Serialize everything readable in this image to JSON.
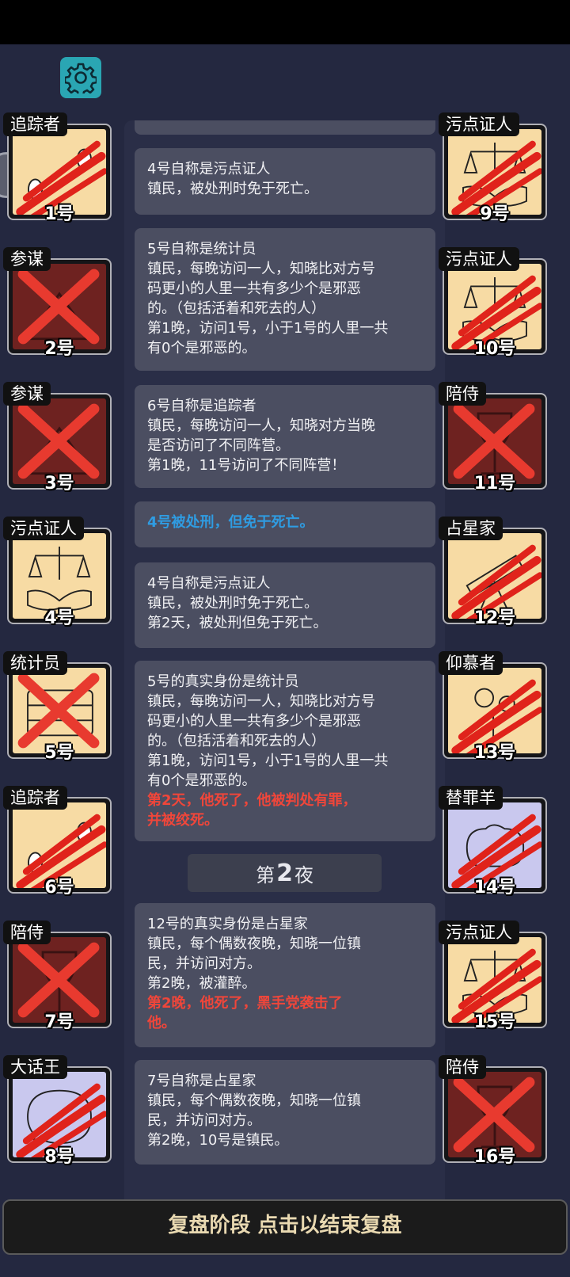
{
  "settings": {
    "icon": "gear-icon"
  },
  "log": {
    "entries": [
      {
        "lines": [
          "4号自称是污点证人",
          "镇民，被处刑时免于死亡。"
        ],
        "red": []
      },
      {
        "lines": [
          "5号自称是统计员",
          "镇民，每晚访问一人，知晓比对方号",
          "码更小的人里一共有多少个是邪恶",
          "的。（包括活着和死去的人）",
          "第1晚，访问1号，小于1号的人里一共",
          "有0个是邪恶的。"
        ],
        "red": []
      },
      {
        "lines": [
          "6号自称是追踪者",
          "镇民，每晚访问一人，知晓对方当晚",
          "是否访问了不同阵营。",
          "第1晚，11号访问了不同阵营！"
        ],
        "red": []
      },
      {
        "lines": [
          "4号被处刑，但免于死亡。"
        ],
        "red": [],
        "blue": true
      },
      {
        "lines": [
          "4号自称是污点证人",
          "镇民，被处刑时免于死亡。",
          "第2天，被处刑但免于死亡。"
        ],
        "red": []
      },
      {
        "lines": [
          "5号的真实身份是统计员",
          "镇民，每晚访问一人，知晓比对方号",
          "码更小的人里一共有多少个是邪恶",
          "的。（包括活着和死去的人）",
          "第1晚，访问1号，小于1号的人里一共",
          "有0个是邪恶的。"
        ],
        "red": [
          "第2天，他死了，他被判处有罪，",
          "并被绞死。"
        ]
      },
      {
        "lines": [
          "12号的真实身份是占星家",
          "镇民，每个偶数夜晚，知晓一位镇",
          "民，并访问对方。",
          "第2晚，被灌醉。"
        ],
        "red": [
          "第2晚，他死了，黑手党袭击了",
          "他。"
        ]
      },
      {
        "lines": [
          "7号自称是占星家",
          "镇民，每个偶数夜晚，知晓一位镇",
          "民，并访问对方。",
          "第2晚，10号是镇民。"
        ],
        "red": []
      }
    ],
    "night_prefix": "第",
    "night_number": "2",
    "night_suffix": "夜"
  },
  "players": [
    {
      "role": "追踪者",
      "label": "1号",
      "art": "tracker-art",
      "status": "claw",
      "bg": "#f7dba4"
    },
    {
      "role": "参谋",
      "label": "2号",
      "art": "advisor-art",
      "status": "cross",
      "bg": "#6e2220"
    },
    {
      "role": "参谋",
      "label": "3号",
      "art": "advisor-art",
      "status": "cross",
      "bg": "#6e2220"
    },
    {
      "role": "污点证人",
      "label": "4号",
      "art": "scales-handshake-art",
      "status": "none",
      "bg": "#f7dba4"
    },
    {
      "role": "统计员",
      "label": "5号",
      "art": "abacus-art",
      "status": "cross",
      "bg": "#f7dba4"
    },
    {
      "role": "追踪者",
      "label": "6号",
      "art": "tracker-art",
      "status": "claw",
      "bg": "#f7dba4"
    },
    {
      "role": "陪侍",
      "label": "7号",
      "art": "wineglass-art",
      "status": "cross",
      "bg": "#6e2220"
    },
    {
      "role": "大话王",
      "label": "8号",
      "art": "bubble-art",
      "status": "claw",
      "bg": "#c9c8ee"
    },
    {
      "role": "污点证人",
      "label": "9号",
      "art": "scales-handshake-art",
      "status": "claw",
      "bg": "#f7dba4"
    },
    {
      "role": "污点证人",
      "label": "10号",
      "art": "scales-handshake-art",
      "status": "claw",
      "bg": "#f7dba4"
    },
    {
      "role": "陪侍",
      "label": "11号",
      "art": "wineglass-art",
      "status": "cross",
      "bg": "#6e2220"
    },
    {
      "role": "占星家",
      "label": "12号",
      "art": "telescope-art",
      "status": "claw",
      "bg": "#f7dba4"
    },
    {
      "role": "仰慕者",
      "label": "13号",
      "art": "flowers-art",
      "status": "claw",
      "bg": "#f7dba4"
    },
    {
      "role": "替罪羊",
      "label": "14号",
      "art": "sheep-art",
      "status": "claw",
      "bg": "#c9c8ee"
    },
    {
      "role": "污点证人",
      "label": "15号",
      "art": "scales-handshake-art",
      "status": "claw",
      "bg": "#f7dba4"
    },
    {
      "role": "陪侍",
      "label": "16号",
      "art": "wineglass-art",
      "status": "cross",
      "bg": "#6e2220"
    }
  ],
  "bottom_bar": {
    "label": "复盘阶段 点击以结束复盘"
  }
}
